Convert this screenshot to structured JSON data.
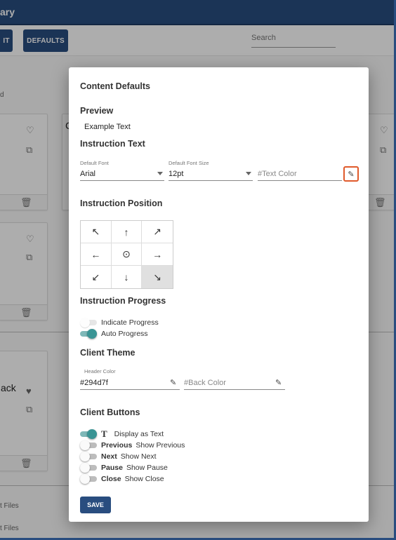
{
  "app": {
    "title": "ary"
  },
  "toolbar": {
    "left_button": "IT",
    "defaults_button": "DEFAULTS",
    "search_placeholder": "Search"
  },
  "background": {
    "card_title_left": "ack",
    "card_title_right": "C",
    "text_d": "d",
    "files_1": "t Files",
    "files_2": "t Files"
  },
  "modal": {
    "title": "Content Defaults",
    "preview_heading": "Preview",
    "preview_text": "Example Text",
    "instruction_text_heading": "Instruction Text",
    "default_font_label": "Default Font",
    "default_font_value": "Arial",
    "default_font_size_label": "Default Font Size",
    "default_font_size_value": "12pt",
    "text_color_placeholder": "#Text Color",
    "instruction_position_heading": "Instruction Position",
    "position_arrows": [
      "↖",
      "↑",
      "↗",
      "←",
      "⊙",
      "→",
      "↙",
      "↓",
      "↘"
    ],
    "selected_position": "bottom-right",
    "instruction_progress_heading": "Instruction Progress",
    "indicate_progress_label": "Indicate Progress",
    "indicate_progress_on": false,
    "auto_progress_label": "Auto Progress",
    "auto_progress_on": true,
    "client_theme_heading": "Client Theme",
    "header_color_label": "Header Color",
    "header_color_value": "#294d7f",
    "back_color_placeholder": "#Back Color",
    "client_buttons_heading": "Client Buttons",
    "display_as_text_glyph": "T",
    "display_as_text_label": "Display as Text",
    "display_as_text_on": true,
    "buttons": [
      {
        "name": "Previous",
        "label": "Show Previous",
        "on": false
      },
      {
        "name": "Next",
        "label": "Show Next",
        "on": false
      },
      {
        "name": "Pause",
        "label": "Show Pause",
        "on": false
      },
      {
        "name": "Close",
        "label": "Show Close",
        "on": false
      }
    ],
    "save_label": "SAVE"
  },
  "colors": {
    "primary": "#294d7f",
    "accent": "#3a9494",
    "picker_highlight": "#e05a2b"
  }
}
